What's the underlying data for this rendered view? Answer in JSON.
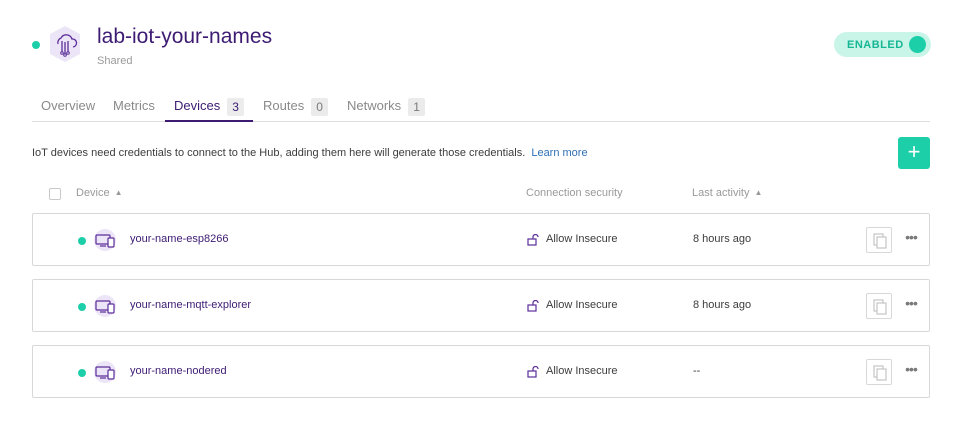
{
  "hub": {
    "title": "lab-iot-your-names",
    "subtitle": "Shared",
    "icon": "cloud-iot-icon",
    "status_color": "#1ccfa8",
    "enabled_label": "ENABLED"
  },
  "tabs": [
    {
      "label": "Overview",
      "count": null,
      "active": false
    },
    {
      "label": "Metrics",
      "count": null,
      "active": false
    },
    {
      "label": "Devices",
      "count": "3",
      "active": true
    },
    {
      "label": "Routes",
      "count": "0",
      "active": false
    },
    {
      "label": "Networks",
      "count": "1",
      "active": false
    }
  ],
  "info": {
    "text": "IoT devices need credentials to connect to the Hub, adding them here will generate those credentials.",
    "link_label": "Learn more"
  },
  "add_button": {
    "label": "+"
  },
  "table": {
    "columns": {
      "device": "Device",
      "security": "Connection security",
      "activity": "Last activity"
    },
    "rows": [
      {
        "name": "your-name-esp8266",
        "security": "Allow Insecure",
        "activity": "8 hours ago",
        "status_color": "#1ccfa8"
      },
      {
        "name": "your-name-mqtt-explorer",
        "security": "Allow Insecure",
        "activity": "8 hours ago",
        "status_color": "#1ccfa8"
      },
      {
        "name": "your-name-nodered",
        "security": "Allow Insecure",
        "activity": "--",
        "status_color": "#1ccfa8"
      }
    ],
    "more_label": "•••"
  },
  "colors": {
    "brand_purple": "#3d1b73",
    "accent_green": "#1ccfa8",
    "link_blue": "#2f6fb5"
  }
}
